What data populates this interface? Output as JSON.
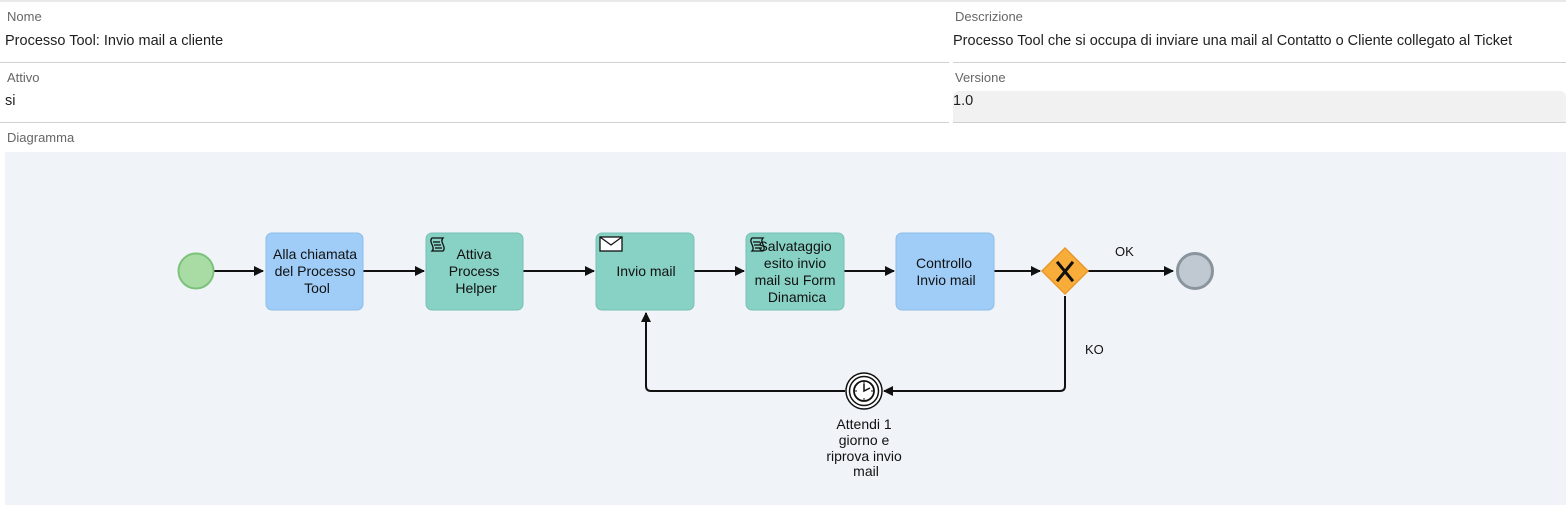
{
  "form": {
    "nome": {
      "label": "Nome",
      "value": "Processo Tool: Invio mail a cliente"
    },
    "descrizione": {
      "label": "Descrizione",
      "value": "Processo Tool che si occupa di inviare una mail al Contatto o Cliente collegato al Ticket"
    },
    "attivo": {
      "label": "Attivo",
      "value": "si"
    },
    "versione": {
      "label": "Versione",
      "value": "1.0"
    },
    "diagramma": {
      "label": "Diagramma"
    }
  },
  "diagram": {
    "colors": {
      "user_task": "#9fcdf8",
      "service_task": "#88d1c5",
      "start_event": "#a9dca5",
      "end_event": "#c0c9d2",
      "gateway": "#f8ac3a"
    },
    "tasks": {
      "t1": [
        "Alla chiamata",
        "del Processo",
        "Tool"
      ],
      "t2": [
        "Attiva",
        "Process",
        "Helper"
      ],
      "t3": [
        "Invio mail"
      ],
      "t4": [
        "Salvataggio",
        "esito invio",
        "mail su Form",
        "Dinamica"
      ],
      "t5": [
        "Controllo",
        "Invio mail"
      ]
    },
    "timer_label": [
      "Attendi 1",
      "giorno e",
      "riprova invio",
      "mail"
    ],
    "edges": {
      "ok": "OK",
      "ko": "KO"
    },
    "icons": {
      "t2": "script-icon",
      "t3": "envelope-icon",
      "t4": "script-icon",
      "timer": "clock-icon",
      "gateway": "exclusive-gateway-x-icon"
    }
  }
}
